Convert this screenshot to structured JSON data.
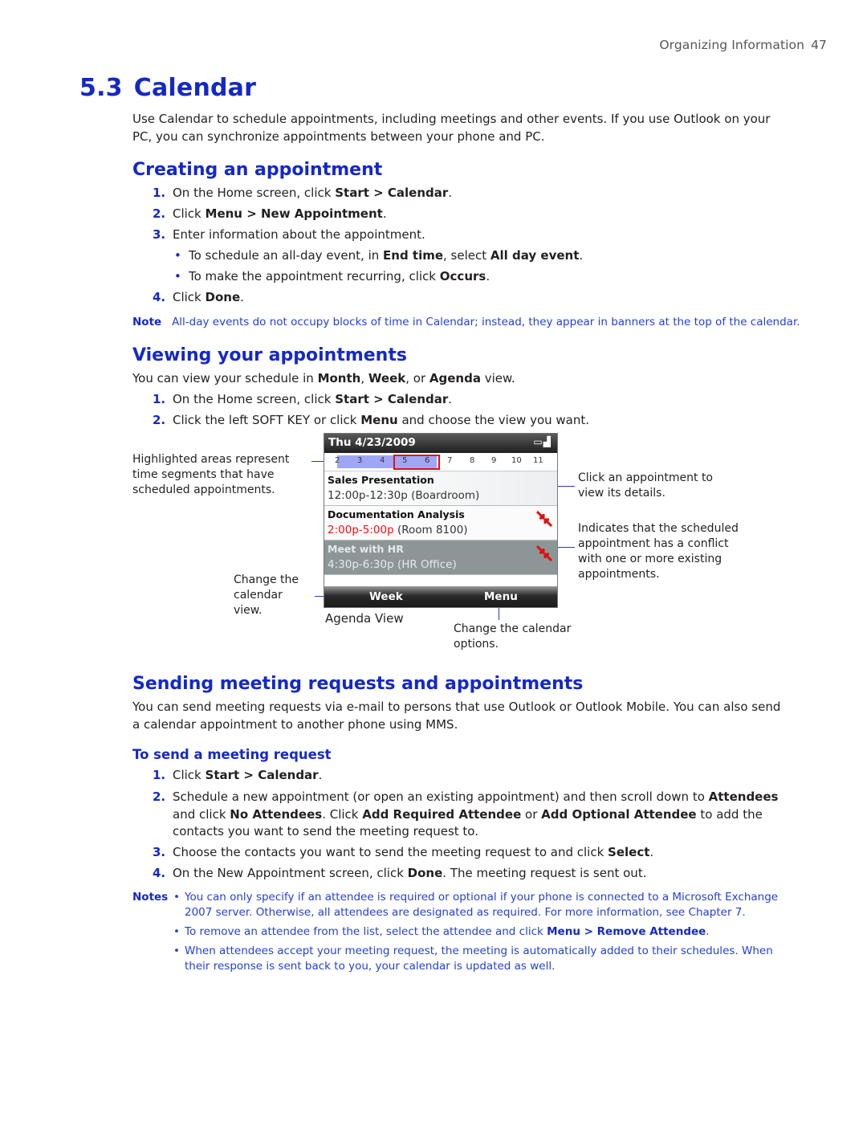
{
  "running_head": {
    "section": "Organizing Information",
    "page": "47"
  },
  "chapter": {
    "number": "5.3",
    "title": "Calendar"
  },
  "intro": "Use Calendar to schedule appointments, including meetings and other events. If you use Outlook on your PC, you can synchronize appointments between your phone and PC.",
  "creating": {
    "heading": "Creating an appointment",
    "steps": [
      {
        "n": "1.",
        "pre": "On the Home screen, click ",
        "bold": "Start > Calendar",
        "post": "."
      },
      {
        "n": "2.",
        "pre": "Click ",
        "bold": "Menu > New Appointment",
        "post": "."
      },
      {
        "n": "3.",
        "pre": "Enter information about the appointment.",
        "bold": "",
        "post": ""
      },
      {
        "n": "4.",
        "pre": "Click ",
        "bold": "Done",
        "post": "."
      }
    ],
    "bullets": [
      {
        "pre": "To schedule an all-day event, in ",
        "b1": "End time",
        "mid": ", select ",
        "b2": "All day event",
        "post": "."
      },
      {
        "pre": "To make the appointment recurring, click ",
        "b1": "Occurs",
        "post": "."
      }
    ],
    "note_label": "Note",
    "note_text": "All-day events do not occupy blocks of time in Calendar; instead, they appear in banners at the top of the calendar."
  },
  "viewing": {
    "heading": "Viewing your appointments",
    "intro": {
      "pre": "You can view your schedule in ",
      "b1": "Month",
      "s1": ", ",
      "b2": "Week",
      "s2": ", or ",
      "b3": "Agenda",
      "post": " view."
    },
    "steps": [
      {
        "n": "1.",
        "pre": "On the Home screen, click ",
        "bold": "Start > Calendar",
        "post": "."
      },
      {
        "n": "2.",
        "pre": "Click the left SOFT KEY or click ",
        "bold": "Menu",
        "post": " and choose the view you want."
      }
    ]
  },
  "figure": {
    "caption": "Agenda View",
    "callouts": {
      "highlighted": "Highlighted areas represent time segments that have scheduled appointments.",
      "change_view": "Change the calendar view.",
      "click_appt": "Click an appointment to view its details.",
      "conflict": "Indicates that the scheduled appointment has a conflict with one or more existing appointments.",
      "options": "Change the calendar options."
    },
    "phone": {
      "date": "Thu 4/23/2009",
      "status_icons": [
        "battery-icon",
        "signal-icon"
      ],
      "hours": [
        "2",
        "3",
        "4",
        "5",
        "6",
        "7",
        "8",
        "9",
        "10",
        "11"
      ],
      "highlight_color": "#a0a6f6",
      "conflict_color": "#e01010",
      "appointments": [
        {
          "title": "Sales Presentation",
          "time": "12:00p-12:30p",
          "place": "(Boardroom)",
          "conflict": false,
          "selected": false
        },
        {
          "title": "Documentation Analysis",
          "time": "2:00p-5:00p",
          "place": "(Room 8100)",
          "conflict": true,
          "selected": false
        },
        {
          "title": "Meet with HR",
          "time": "4:30p-6:30p",
          "place": "(HR Office)",
          "conflict": true,
          "selected": true
        }
      ],
      "softkey_left": "Week",
      "softkey_right": "Menu"
    }
  },
  "sending": {
    "heading": "Sending meeting requests and appointments",
    "intro": "You can send meeting requests via e-mail to persons that use Outlook or Outlook Mobile. You can also send a calendar appointment to another phone using MMS.",
    "subheading": "To send a meeting request",
    "step1": {
      "n": "1.",
      "pre": "Click ",
      "bold": "Start > Calendar",
      "post": "."
    },
    "step2": {
      "n": "2.",
      "a": "Schedule a new appointment (or open an existing appointment) and then scroll down to ",
      "b1": "Attendees",
      "c": " and click ",
      "b2": "No Attendees",
      "d": ". Click ",
      "b3": "Add Required Attendee",
      "e": " or ",
      "b4": "Add Optional Attendee",
      "f": " to add the contacts you want to send the meeting request to."
    },
    "step3": {
      "n": "3.",
      "pre": "Choose the contacts you want to send the meeting request to and click ",
      "bold": "Select",
      "post": "."
    },
    "step4": {
      "n": "4.",
      "pre": "On the New Appointment screen, click ",
      "bold": "Done",
      "post": ". The meeting request is sent out."
    },
    "notes_label": "Notes",
    "notes": [
      {
        "text": "You can only specify if an attendee is required or optional if your phone is connected to a Microsoft Exchange 2007 server. Otherwise, all attendees are designated as required. For more information, see Chapter 7."
      },
      {
        "pre": "To remove an attendee from the list, select the attendee and click ",
        "bold": "Menu > Remove Attendee",
        "post": "."
      },
      {
        "text": "When attendees accept your meeting request, the meeting is automatically added to their schedules. When their response is sent back to you, your calendar is updated as well."
      }
    ]
  }
}
